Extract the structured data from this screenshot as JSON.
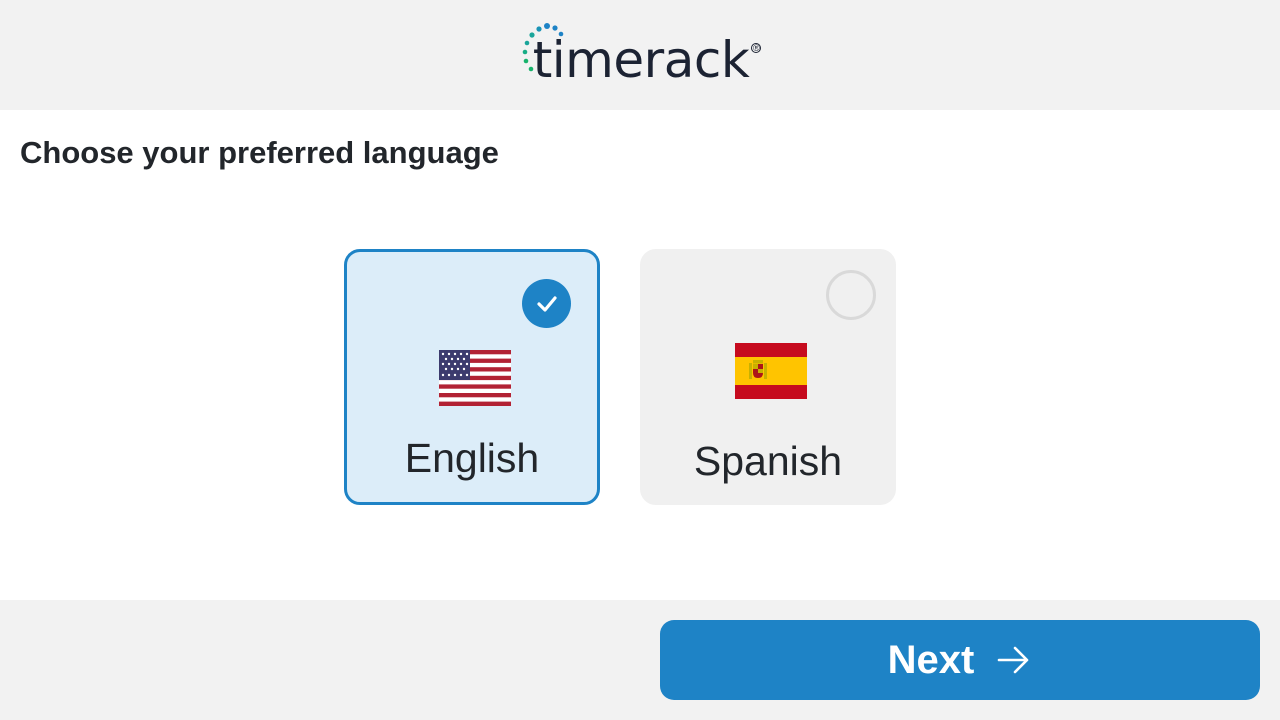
{
  "header": {
    "logo_text": "timerack",
    "logo_mark": "®",
    "logo_color": "#1c2333",
    "logo_dot_colors": [
      "#1e83c6",
      "#1aa59a",
      "#18b36c"
    ]
  },
  "main": {
    "title": "Choose your preferred language",
    "languages": [
      {
        "label": "English",
        "flag_icon": "us-flag-icon",
        "selected": true
      },
      {
        "label": "Spanish",
        "flag_icon": "spain-flag-icon",
        "selected": false
      }
    ]
  },
  "footer": {
    "next_label": "Next",
    "next_icon": "arrow-right-icon"
  },
  "colors": {
    "accent": "#1e83c6",
    "selected_card_bg": "#dcedf9",
    "unselected_card_bg": "#f0f0f0",
    "header_footer_bg": "#f2f2f2"
  }
}
